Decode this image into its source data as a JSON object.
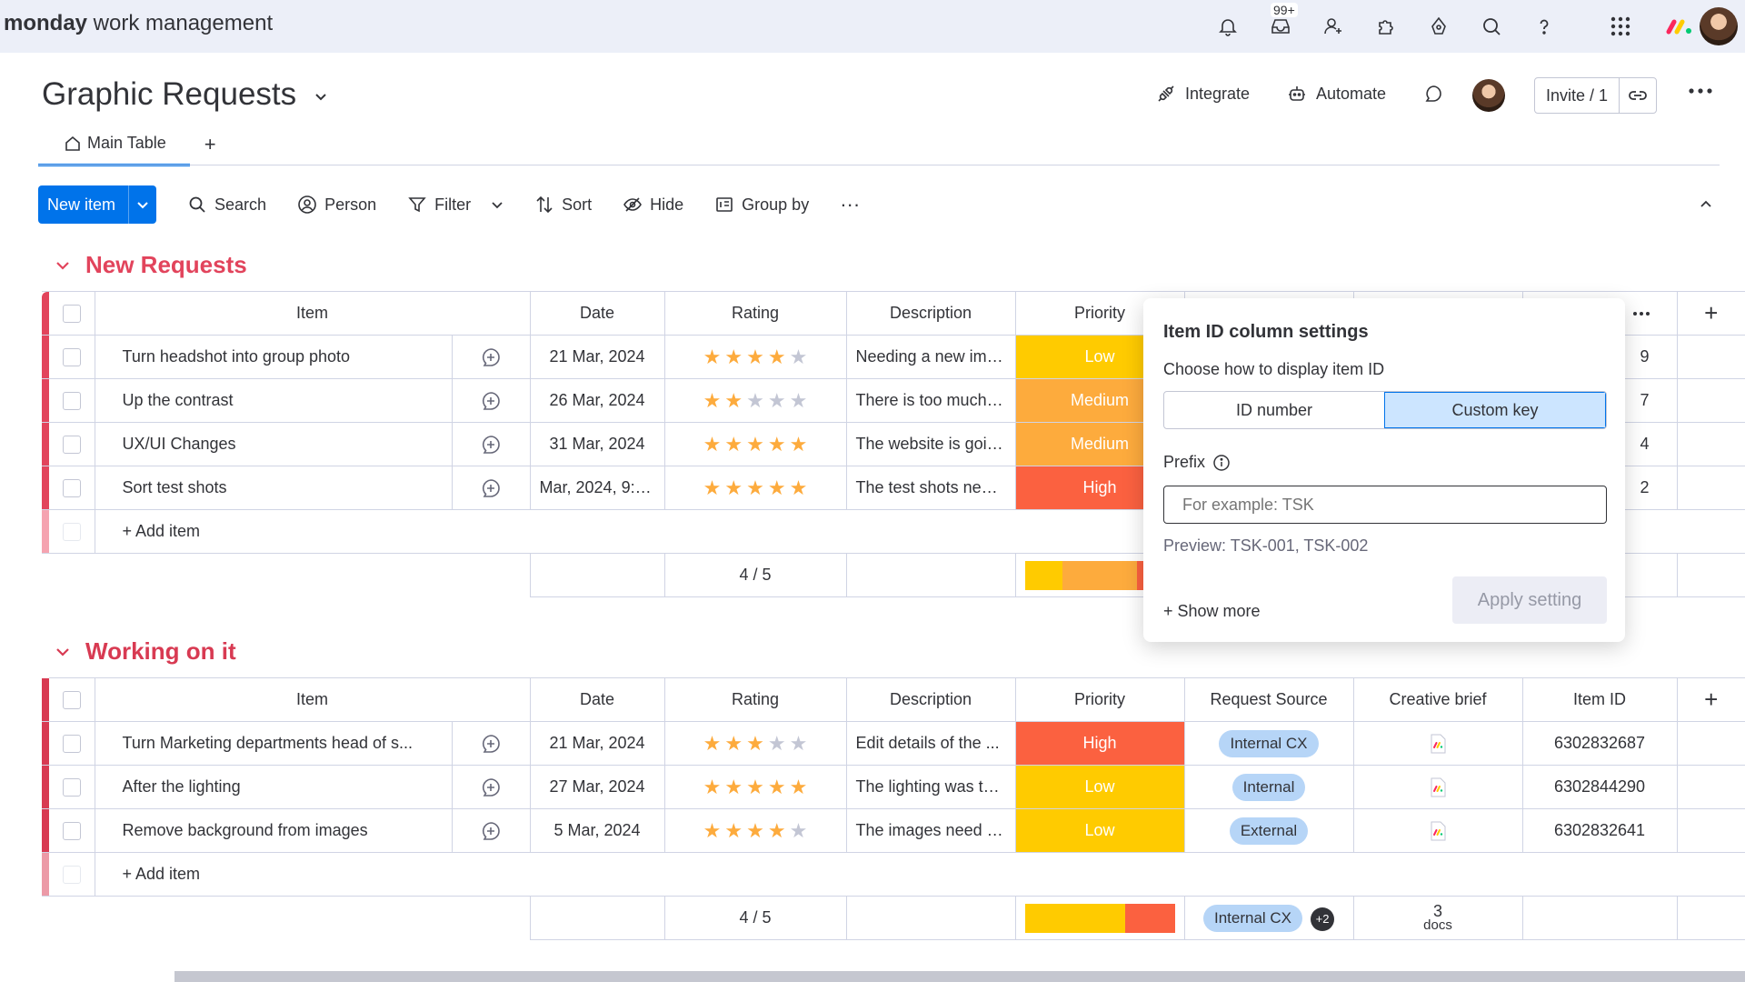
{
  "topbar": {
    "logo_bold": "monday",
    "logo_rest": " work management",
    "inbox_badge": "99+",
    "icons": [
      "bell-icon",
      "inbox-icon",
      "invite-members-icon",
      "apps-icon",
      "ai-icon",
      "search-icon",
      "help-icon",
      "grid-menu-icon",
      "monday-logo-icon",
      "user-avatar"
    ]
  },
  "header": {
    "title": "Graphic Requests",
    "integrate": "Integrate",
    "automate": "Automate",
    "invite": "Invite / 1"
  },
  "tabs": {
    "main": "Main Table",
    "add": "+"
  },
  "toolbar": {
    "new_item": "New item",
    "search": "Search",
    "person": "Person",
    "filter": "Filter",
    "sort": "Sort",
    "hide": "Hide",
    "group_by": "Group by",
    "more": "···"
  },
  "columns": [
    "Item",
    "Date",
    "Rating",
    "Description",
    "Priority",
    "Request Source",
    "Creative brief",
    "Item ID"
  ],
  "groups": [
    {
      "title": "New Requests",
      "color": "#e2445c",
      "rows": [
        {
          "item": "Turn headshot into group photo",
          "date": "21 Mar, 2024",
          "rating": 4,
          "description": "Needing a new ima...",
          "priority": "Low",
          "priority_color": "#ffcb00",
          "id_tail": "9"
        },
        {
          "item": "Up the contrast",
          "date": "26 Mar, 2024",
          "rating": 2,
          "description": "There is too much e...",
          "priority": "Medium",
          "priority_color": "#fdab3d",
          "id_tail": "7"
        },
        {
          "item": "UX/UI Changes",
          "date": "31 Mar, 2024",
          "rating": 5,
          "description": "The website is goin...",
          "priority": "Medium",
          "priority_color": "#fdab3d",
          "id_tail": "4"
        },
        {
          "item": "Sort test shots",
          "date": "Mar, 2024, 9:00 ...",
          "rating": 5,
          "description": "The test shots need...",
          "priority": "High",
          "priority_color": "#fb6140",
          "id_tail": "2"
        }
      ],
      "add_item": "+ Add item",
      "rating_summary": "4 / 5"
    },
    {
      "title": "Working on it",
      "color": "#d83a52",
      "rows": [
        {
          "item": "Turn Marketing departments head of s...",
          "date": "21 Mar, 2024",
          "rating": 3,
          "description": "Edit details of the ...",
          "priority": "High",
          "priority_color": "#fb6140",
          "source": "Internal CX",
          "item_id": "6302832687"
        },
        {
          "item": "After the lighting",
          "date": "27 Mar, 2024",
          "rating": 5,
          "description": "The lighting was to...",
          "priority": "Low",
          "priority_color": "#ffcb00",
          "source": "Internal",
          "item_id": "6302844290"
        },
        {
          "item": "Remove background from images",
          "date": "5 Mar, 2024",
          "rating": 4,
          "description": "The images need to...",
          "priority": "Low",
          "priority_color": "#ffcb00",
          "source": "External",
          "item_id": "6302832641"
        }
      ],
      "add_item": "+ Add item",
      "rating_summary": "4 / 5",
      "source_summary": "Internal CX",
      "source_summary_extra": "+2",
      "docs_count": "3",
      "docs_label": "docs"
    }
  ],
  "popup": {
    "title": "Item ID column settings",
    "subtitle": "Choose how to display item ID",
    "option_id": "ID number",
    "option_custom": "Custom key",
    "prefix_label": "Prefix",
    "prefix_placeholder": "For example: TSK",
    "preview": "Preview: TSK-001, TSK-002",
    "show_more": "+ Show more",
    "apply": "Apply setting"
  },
  "colors": {
    "accent": "#0073ea",
    "group1": "#e2445c",
    "group2": "#d83a52",
    "low": "#ffcb00",
    "medium": "#fdab3d",
    "high": "#fb6140"
  }
}
